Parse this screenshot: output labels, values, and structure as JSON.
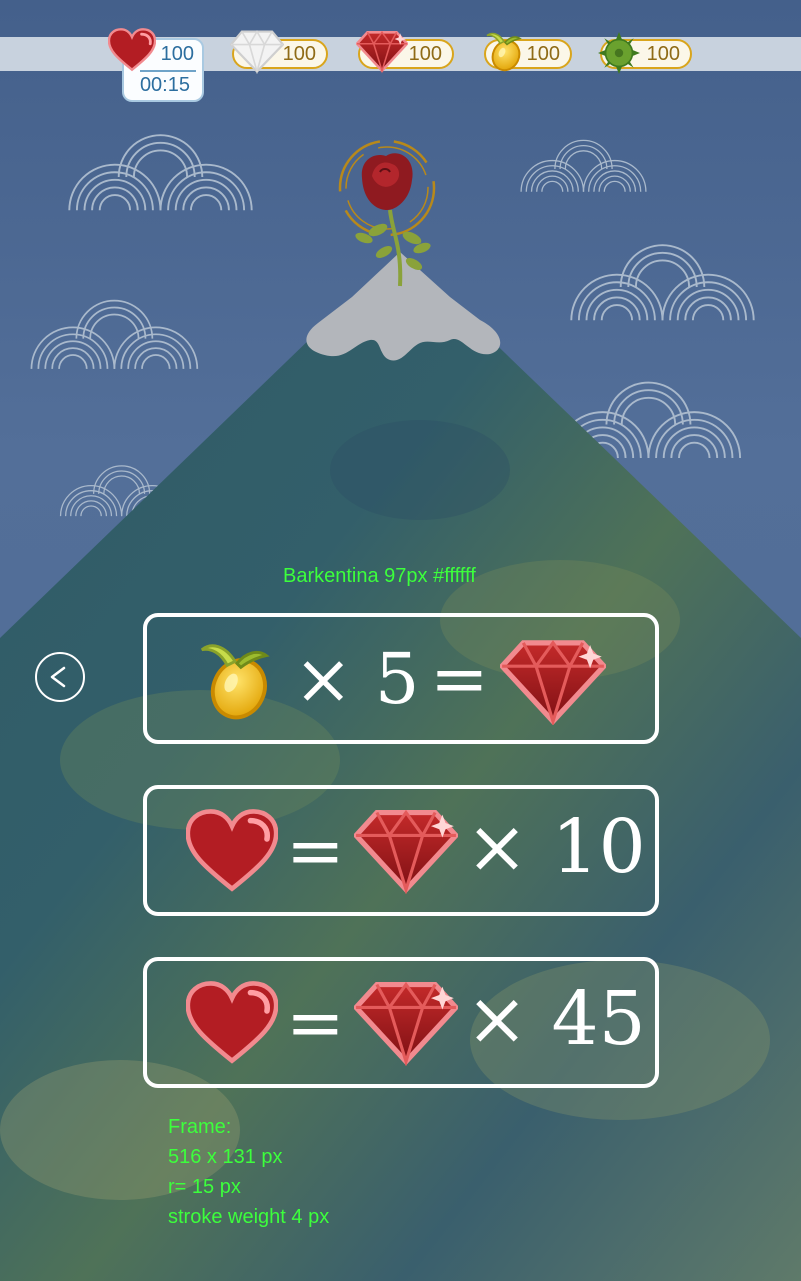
{
  "top_bar": {
    "lives": {
      "icon": "heart-icon",
      "count": "100",
      "timer": "00:15"
    },
    "resources": [
      {
        "icon": "white-diamond-icon",
        "value": "100"
      },
      {
        "icon": "red-gem-icon",
        "value": "100"
      },
      {
        "icon": "golden-seed-icon",
        "value": "100"
      },
      {
        "icon": "green-spiky-ball-icon",
        "value": "100"
      }
    ]
  },
  "annotations": {
    "font_note": "Barkentina 97px #ffffff",
    "frame_note": [
      "Frame:",
      "516 x 131 px",
      "r= 15 px",
      "stroke weight 4 px"
    ]
  },
  "exchange": [
    {
      "left_icon": "golden-seed-icon",
      "multiplier": "× 5",
      "equals": "=",
      "right_icon": "red-gem-icon"
    },
    {
      "left_icon": "heart-icon",
      "equals": "=",
      "right_icon": "red-gem-icon",
      "multiplier": "× 10"
    },
    {
      "left_icon": "heart-icon",
      "equals": "=",
      "right_icon": "red-gem-icon",
      "multiplier": "× 45"
    }
  ],
  "back_button": {
    "icon": "chevron-left-icon"
  },
  "colors": {
    "sky": "#4d6992",
    "accent_gold": "#d9a51c",
    "note_green": "#3cff3c",
    "frame_stroke": "#ffffff"
  }
}
